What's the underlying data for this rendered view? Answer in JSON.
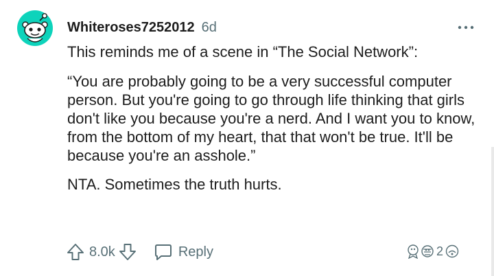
{
  "comment": {
    "username": "Whiteroses7252012",
    "age": "6d",
    "paragraphs": [
      "This reminds me of a scene in “The Social Network”:",
      "“You are probably going to be a very successful computer person. But you're going to go through life thinking that girls don't like you because you're a nerd. And I want you to know, from the bottom of my heart, that that won't be true. It'll be because you're an asshole.”",
      "NTA. Sometimes the truth hurts."
    ]
  },
  "actions": {
    "score": "8.0k",
    "reply_label": "Reply",
    "award_count": "2"
  },
  "icons": {
    "avatar": "reddit-snoo-avatar-icon",
    "more": "more-options-icon",
    "upvote": "upvote-arrow-icon",
    "downvote": "downvote-arrow-icon",
    "reply": "chat-bubble-icon",
    "awards": "award-icons"
  },
  "colors": {
    "avatar_bg": "#0dd3bb",
    "text": "#1c1c1c",
    "meta": "#576f76"
  }
}
